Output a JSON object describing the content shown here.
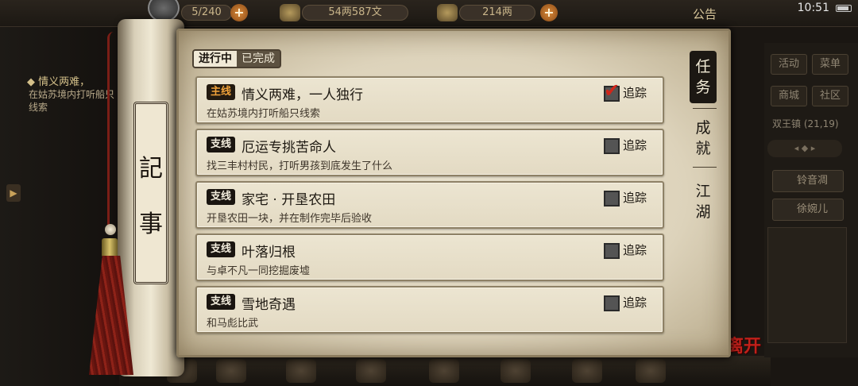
{
  "hud": {
    "stamina": "5/240",
    "money": "54两587文",
    "ingots": "214两",
    "notice_label": "公告",
    "clock": "10:51"
  },
  "left_panel": {
    "quest_title": "◆ 情义两难，",
    "quest_desc": "在姑苏境内打听船只线索"
  },
  "right_panel": {
    "buttons": [
      "活动",
      "菜单",
      "商城",
      "社区"
    ],
    "location": "双王镇 (21,19)",
    "npcs": [
      "铃音凋",
      "徐婉儿"
    ],
    "leave_label": "离开"
  },
  "scroll": {
    "label_chars": [
      "記",
      "事"
    ]
  },
  "status_tabs": {
    "in_progress": "进行中",
    "completed": "已完成"
  },
  "category_tabs": [
    {
      "label": "任务"
    },
    {
      "label": "成就"
    },
    {
      "label": "江湖"
    }
  ],
  "quests": [
    {
      "type": "主线",
      "title": "情义两难，一人独行",
      "desc": "在姑苏境内打听船只线索",
      "tracked": true,
      "track_label": "追踪"
    },
    {
      "type": "支线",
      "title": "厄运专挑苦命人",
      "desc": "找三丰村村民，打听男孩到底发生了什么",
      "tracked": false,
      "track_label": "追踪"
    },
    {
      "type": "支线",
      "title": "家宅 · 开垦农田",
      "desc": "开垦农田一块，并在制作完毕后验收",
      "tracked": false,
      "track_label": "追踪"
    },
    {
      "type": "支线",
      "title": "叶落归根",
      "desc": "与卓不凡一同挖掘废墟",
      "tracked": false,
      "track_label": "追踪"
    },
    {
      "type": "支线",
      "title": "雪地奇遇",
      "desc": "和马彪比武",
      "tracked": false,
      "track_label": "追踪"
    }
  ],
  "colors": {
    "main_badge_text": "#f0a23a",
    "check_mark": "#d0261a",
    "parchment": "#e9e2cf"
  }
}
